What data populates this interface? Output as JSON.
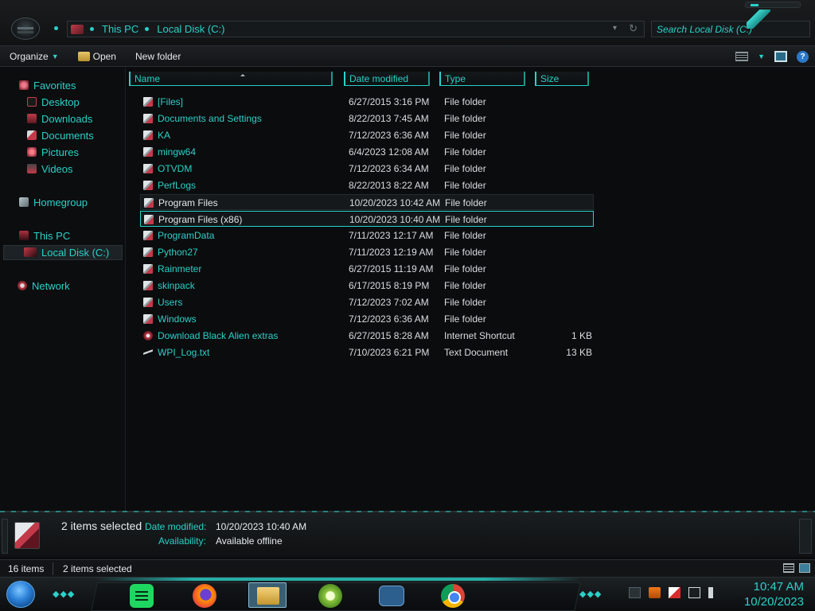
{
  "address_bar": {
    "crumbs": [
      "This PC",
      "Local Disk (C:)"
    ],
    "search_placeholder": "Search Local Disk (C:)"
  },
  "toolbar": {
    "organize_label": "Organize",
    "open_label": "Open",
    "new_folder_label": "New folder"
  },
  "navigation": {
    "favorites": "Favorites",
    "desktop": "Desktop",
    "downloads": "Downloads",
    "documents": "Documents",
    "pictures": "Pictures",
    "videos": "Videos",
    "homegroup": "Homegroup",
    "this_pc": "This PC",
    "local_disk": "Local Disk (C:)",
    "network": "Network"
  },
  "columns": {
    "name": "Name",
    "date_modified": "Date modified",
    "type": "Type",
    "size": "Size"
  },
  "files": [
    {
      "name": "[Files]",
      "date": "6/27/2015 3:16 PM",
      "type": "File folder",
      "size": ""
    },
    {
      "name": "Documents and Settings",
      "date": "8/22/2013 7:45 AM",
      "type": "File folder",
      "size": ""
    },
    {
      "name": "KA",
      "date": "7/12/2023 6:36 AM",
      "type": "File folder",
      "size": ""
    },
    {
      "name": "mingw64",
      "date": "6/4/2023 12:08 AM",
      "type": "File folder",
      "size": ""
    },
    {
      "name": "OTVDM",
      "date": "7/12/2023 6:34 AM",
      "type": "File folder",
      "size": ""
    },
    {
      "name": "PerfLogs",
      "date": "8/22/2013 8:22 AM",
      "type": "File folder",
      "size": ""
    },
    {
      "name": "Program Files",
      "date": "10/20/2023 10:42 AM",
      "type": "File folder",
      "size": ""
    },
    {
      "name": "Program Files (x86)",
      "date": "10/20/2023 10:40 AM",
      "type": "File folder",
      "size": ""
    },
    {
      "name": "ProgramData",
      "date": "7/11/2023 12:17 AM",
      "type": "File folder",
      "size": ""
    },
    {
      "name": "Python27",
      "date": "7/11/2023 12:19 AM",
      "type": "File folder",
      "size": ""
    },
    {
      "name": "Rainmeter",
      "date": "6/27/2015 11:19 AM",
      "type": "File folder",
      "size": ""
    },
    {
      "name": "skinpack",
      "date": "6/17/2015 8:19 PM",
      "type": "File folder",
      "size": ""
    },
    {
      "name": "Users",
      "date": "7/12/2023 7:02 AM",
      "type": "File folder",
      "size": ""
    },
    {
      "name": "Windows",
      "date": "7/12/2023 6:36 AM",
      "type": "File folder",
      "size": ""
    },
    {
      "name": "Download Black Alien extras",
      "date": "6/27/2015 8:28 AM",
      "type": "Internet Shortcut",
      "size": "1 KB"
    },
    {
      "name": "WPI_Log.txt",
      "date": "7/10/2023 6:21 PM",
      "type": "Text Document",
      "size": "13 KB"
    }
  ],
  "details": {
    "selection": "2 items selected",
    "date_label": "Date modified:",
    "date_value": "10/20/2023 10:40 AM",
    "availability_label": "Availability:",
    "availability_value": "Available offline"
  },
  "status": {
    "item_count": "16 items",
    "selected_count": "2 items selected"
  },
  "clock": {
    "time": "10:47 AM",
    "date": "10/20/2023"
  },
  "colors": {
    "accent": "#2ad1c9",
    "background": "#0b0c0d",
    "alien_red": "#c23a4a"
  }
}
